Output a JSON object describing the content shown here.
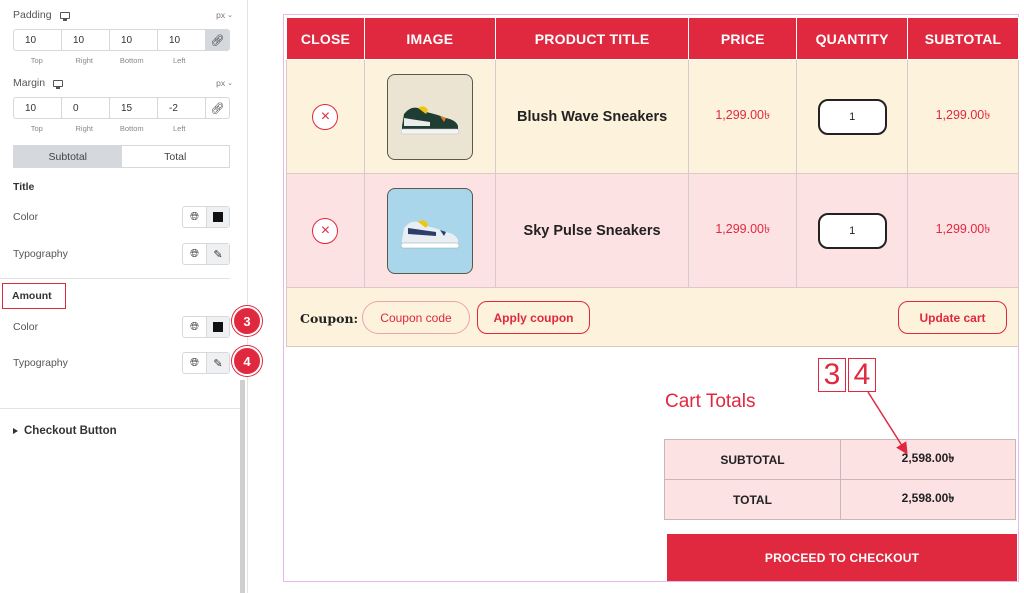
{
  "panel": {
    "padding": {
      "label": "Padding",
      "unit": "px",
      "values": [
        "10",
        "10",
        "10",
        "10"
      ],
      "sub_labels": [
        "Top",
        "Right",
        "Bottom",
        "Left"
      ]
    },
    "margin": {
      "label": "Margin",
      "unit": "px",
      "values": [
        "10",
        "0",
        "15",
        "-2"
      ],
      "sub_labels": [
        "Top",
        "Right",
        "Bottom",
        "Left"
      ]
    },
    "tabs": [
      "Subtotal",
      "Total"
    ],
    "title_section": {
      "heading": "Title",
      "color_label": "Color",
      "typography_label": "Typography"
    },
    "amount_section": {
      "heading": "Amount",
      "color_label": "Color",
      "typography_label": "Typography"
    },
    "badges": [
      "3",
      "4"
    ],
    "checkout_section": "Checkout Button"
  },
  "cart": {
    "columns": [
      "CLOSE",
      "IMAGE",
      "PRODUCT TITLE",
      "PRICE",
      "QUANTITY",
      "SUBTOTAL"
    ],
    "rows": [
      {
        "title": "Blush Wave Sneakers",
        "price": "1,299.00৳",
        "quantity": "1",
        "subtotal": "1,299.00৳",
        "remove": "×"
      },
      {
        "title": "Sky Pulse Sneakers",
        "price": "1,299.00৳",
        "quantity": "1",
        "subtotal": "1,299.00৳",
        "remove": "×"
      }
    ],
    "coupon": {
      "label": "Coupon:",
      "placeholder": "Coupon code",
      "apply": "Apply coupon",
      "update": "Update cart"
    },
    "totals": {
      "title": "Cart Totals",
      "subtotal_label": "SUBTOTAL",
      "subtotal_value": "2,598.00৳",
      "total_label": "TOTAL",
      "total_value": "2,598.00৳"
    },
    "checkout_label": "PROCEED TO CHECKOUT"
  },
  "annotation": {
    "digits": [
      "3",
      "4"
    ]
  },
  "colors": {
    "accent": "#e0283f",
    "row_a": "#fdf2dc",
    "row_b": "#fde2e4"
  },
  "icons": [
    "monitor-icon",
    "chevron-down-icon",
    "link-icon",
    "globe-icon",
    "pencil-icon",
    "color-swatch-icon",
    "close-icon",
    "sneaker-image",
    "caret-right-icon"
  ]
}
